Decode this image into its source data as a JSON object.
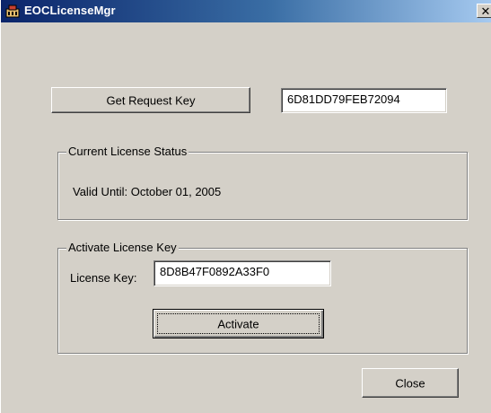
{
  "window": {
    "title": "EOCLicenseMgr",
    "close_glyph": "✕"
  },
  "request": {
    "button_label": "Get Request Key",
    "key_value": "6D81DD79FEB72094"
  },
  "status": {
    "group_title": "Current License Status",
    "text": "Valid Until: October 01, 2005"
  },
  "activate": {
    "group_title": "Activate License Key",
    "field_label": "License Key:",
    "field_value": "8D8B47F0892A33F0",
    "button_label": "Activate"
  },
  "footer": {
    "close_label": "Close"
  },
  "icons": {
    "app": "app-icon",
    "close": "close-icon"
  }
}
